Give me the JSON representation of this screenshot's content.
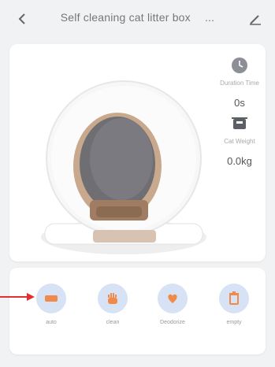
{
  "header": {
    "title": "Self cleaning cat litter box",
    "back_icon": "chevron-left-icon",
    "more_text": "...",
    "edit_icon": "pencil-icon"
  },
  "stats": {
    "duration_label": "Duration Time",
    "duration_value": "0s",
    "weight_label": "Cat Weight",
    "weight_value": "0.0kg"
  },
  "actions": [
    {
      "label": "auto",
      "icon": "auto-icon"
    },
    {
      "label": "clean",
      "icon": "hand-icon"
    },
    {
      "label": "Deodorize",
      "icon": "heart-hand-icon"
    },
    {
      "label": "empty",
      "icon": "trash-icon"
    }
  ],
  "colors": {
    "accent_circle": "#d7e3f5",
    "accent_icon": "#f08a4b",
    "arrow": "#e03030"
  }
}
